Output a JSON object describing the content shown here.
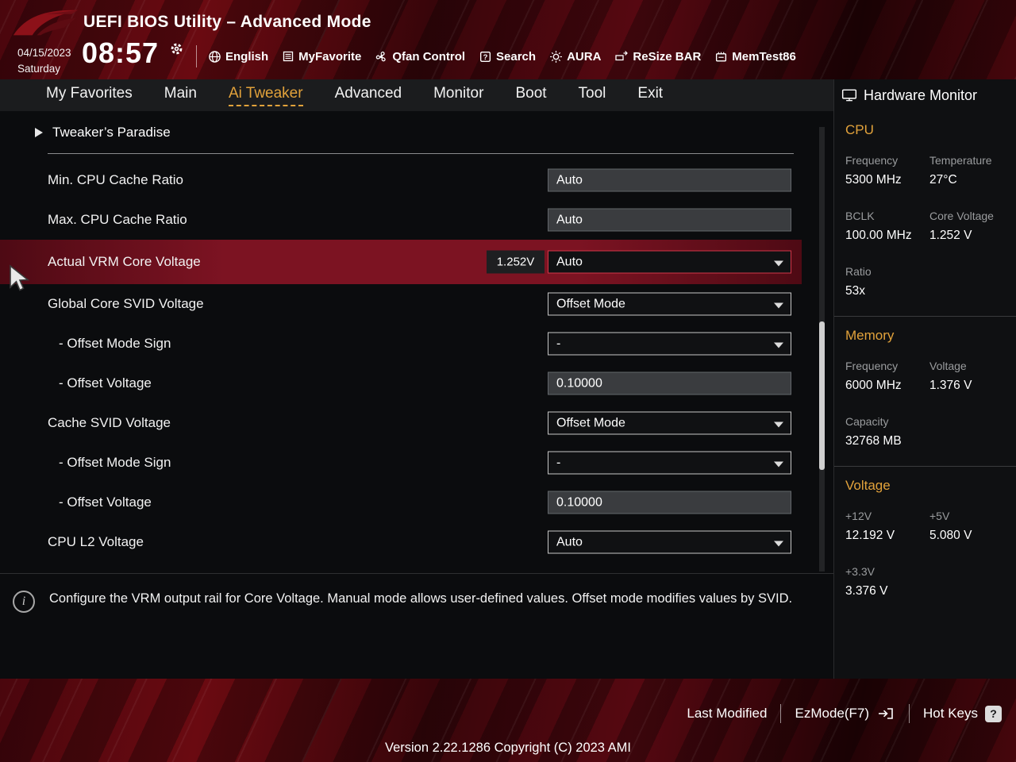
{
  "header": {
    "title": "UEFI BIOS Utility – Advanced Mode",
    "date": "04/15/2023",
    "day": "Saturday",
    "time": "08:57",
    "toolbar": [
      {
        "label": "English",
        "icon": "globe-icon"
      },
      {
        "label": "MyFavorite",
        "icon": "favorites-list-icon"
      },
      {
        "label": "Qfan Control",
        "icon": "fan-icon"
      },
      {
        "label": "Search",
        "icon": "search-icon"
      },
      {
        "label": "AURA",
        "icon": "aura-icon"
      },
      {
        "label": "ReSize BAR",
        "icon": "resize-bar-icon"
      },
      {
        "label": "MemTest86",
        "icon": "memtest-icon"
      }
    ]
  },
  "nav": {
    "tabs": [
      {
        "label": "My Favorites",
        "active": false
      },
      {
        "label": "Main",
        "active": false
      },
      {
        "label": "Ai Tweaker",
        "active": true
      },
      {
        "label": "Advanced",
        "active": false
      },
      {
        "label": "Monitor",
        "active": false
      },
      {
        "label": "Boot",
        "active": false
      },
      {
        "label": "Tool",
        "active": false
      },
      {
        "label": "Exit",
        "active": false
      }
    ]
  },
  "content": {
    "breadcrumb": "Tweaker’s Paradise",
    "rows": [
      {
        "label": "Min. CPU Cache Ratio",
        "value": "Auto",
        "control": "input"
      },
      {
        "label": "Max. CPU Cache Ratio",
        "value": "Auto",
        "control": "input"
      },
      {
        "label": "Actual VRM Core Voltage",
        "readout": "1.252V",
        "value": "Auto",
        "control": "select",
        "highlighted": true
      },
      {
        "label": "Global Core SVID Voltage",
        "value": "Offset Mode",
        "control": "select"
      },
      {
        "label": "- Offset Mode Sign",
        "value": "-",
        "control": "select",
        "indent": true
      },
      {
        "label": "- Offset Voltage",
        "value": "0.10000",
        "control": "input",
        "indent": true
      },
      {
        "label": "Cache SVID Voltage",
        "value": "Offset Mode",
        "control": "select"
      },
      {
        "label": "- Offset Mode Sign",
        "value": "-",
        "control": "select",
        "indent": true
      },
      {
        "label": "- Offset Voltage",
        "value": "0.10000",
        "control": "input",
        "indent": true
      },
      {
        "label": "CPU L2 Voltage",
        "value": "Auto",
        "control": "select"
      }
    ],
    "help_text": "Configure the VRM output rail for Core Voltage. Manual mode allows user-defined values. Offset mode modifies values by SVID."
  },
  "hardware_monitor": {
    "title": "Hardware Monitor",
    "sections": [
      {
        "title": "CPU",
        "items": [
          {
            "label": "Frequency",
            "value": "5300 MHz"
          },
          {
            "label": "Temperature",
            "value": "27°C"
          },
          {
            "label": "BCLK",
            "value": "100.00 MHz"
          },
          {
            "label": "Core Voltage",
            "value": "1.252 V"
          },
          {
            "label": "Ratio",
            "value": "53x"
          }
        ]
      },
      {
        "title": "Memory",
        "items": [
          {
            "label": "Frequency",
            "value": "6000 MHz"
          },
          {
            "label": "Voltage",
            "value": "1.376 V"
          },
          {
            "label": "Capacity",
            "value": "32768 MB"
          }
        ]
      },
      {
        "title": "Voltage",
        "items": [
          {
            "label": "+12V",
            "value": "12.192 V"
          },
          {
            "label": "+5V",
            "value": "5.080 V"
          },
          {
            "label": "+3.3V",
            "value": "3.376 V"
          }
        ]
      }
    ]
  },
  "footer": {
    "last_modified": "Last Modified",
    "ezmode": "EzMode(F7)",
    "hot_keys": "Hot Keys",
    "hotkey_badge": "?",
    "version": "Version 2.22.1286 Copyright (C) 2023 AMI"
  },
  "colors": {
    "accent": "#e2a23b",
    "highlight_red": "#7c1322"
  }
}
